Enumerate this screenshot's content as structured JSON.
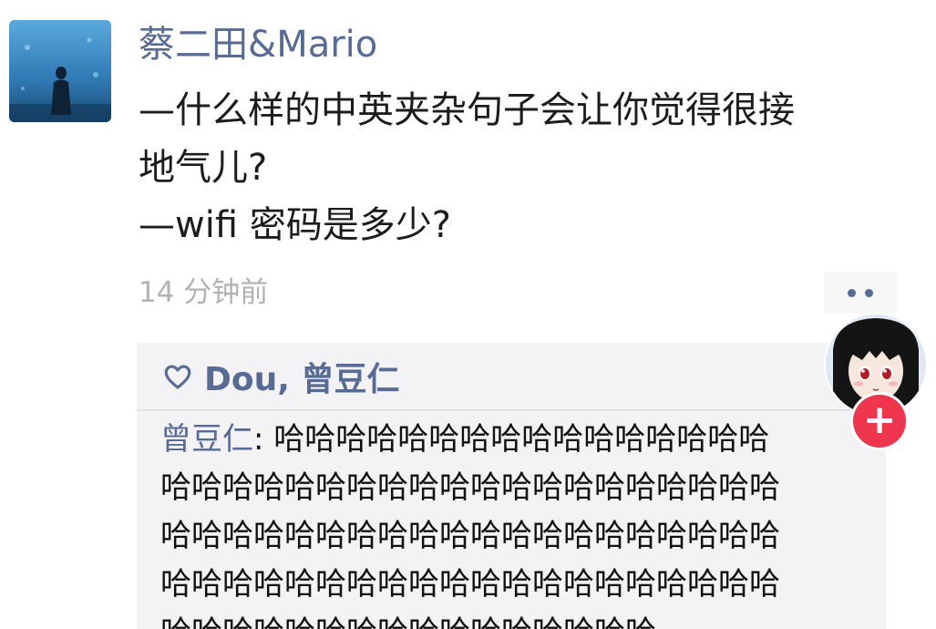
{
  "post": {
    "author": "蔡二田&Mario",
    "lines": [
      "—什么样的中英夹杂句子会让你觉得很接",
      "地气儿?",
      "—wifi 密码是多少?"
    ],
    "timestamp": "14 分钟前"
  },
  "likes": {
    "names": "Dou, 曾豆仁"
  },
  "comment": {
    "author": "曾豆仁",
    "separator": ": ",
    "lines": [
      "哈哈哈哈哈哈哈哈哈哈哈哈哈哈哈哈",
      "哈哈哈哈哈哈哈哈哈哈哈哈哈哈哈哈哈哈哈哈",
      "哈哈哈哈哈哈哈哈哈哈哈哈哈哈哈哈哈哈哈哈",
      "哈哈哈哈哈哈哈哈哈哈哈哈哈哈哈哈哈哈哈哈",
      "哈哈哈哈哈哈哈哈哈哈哈哈哈哈哈哈"
    ]
  },
  "follow": {
    "symbol": "+"
  },
  "colors": {
    "link_blue": "#576b95",
    "comment_bg": "#f3f3f5",
    "follow_red": "#f0354f",
    "timestamp_gray": "#b2b2b2"
  },
  "icons": {
    "like": "heart-outline-icon",
    "more": "more-dots-icon",
    "follow": "plus-icon"
  }
}
